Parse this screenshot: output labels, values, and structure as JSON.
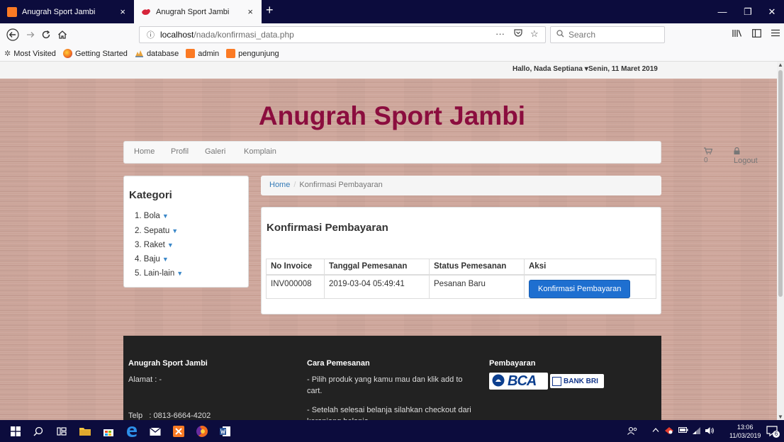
{
  "browser": {
    "tabs": [
      {
        "title": "Anugrah Sport Jambi",
        "close": "×"
      },
      {
        "title": "Anugrah Sport Jambi",
        "close": "×"
      }
    ],
    "new_tab": "+",
    "url_host": "localhost",
    "url_path": "/nada/konfirmasi_data.php",
    "url_actions": [
      "···",
      "☆"
    ],
    "search_placeholder": "Search",
    "window_controls": [
      "—",
      "❐",
      "✕"
    ],
    "bookmarks": [
      "Most Visited",
      "Getting Started",
      "database",
      "admin",
      "pengunjung"
    ]
  },
  "page": {
    "user_menu": "Hallo, Nada Septiana ▾",
    "date": "Senin, 11 Maret 2019",
    "site_title": "Anugrah Sport Jambi",
    "nav": [
      "Home",
      "Profil",
      "Galeri",
      "Komplain"
    ],
    "cart_count": "0",
    "logout": "Logout",
    "kategori": {
      "title": "Kategori",
      "items": [
        "1. Bola",
        "2. Sepatu",
        "3. Raket",
        "4. Baju",
        "5. Lain-lain"
      ]
    },
    "breadcrumb": {
      "home": "Home",
      "sep": "/",
      "current": "Konfirmasi Pembayaran"
    },
    "main": {
      "title": "Konfirmasi Pembayaran",
      "columns": [
        "No Invoice",
        "Tanggal Pemesanan",
        "Status Pemesanan",
        "Aksi"
      ],
      "rows": [
        {
          "invoice": "INV000008",
          "tanggal": "2019-03-04 05:49:41",
          "status": "Pesanan Baru",
          "action": "Konfirmasi Pembayaran"
        }
      ]
    },
    "footer": {
      "col1_title": "Anugrah Sport Jambi",
      "alamat": "Alamat : -",
      "telp": "Telp   : 0813-6664-4202",
      "col2_title": "Cara Pemesanan",
      "step1": "- Pilih produk yang kamu mau dan klik add to cart.",
      "step2": "- Setelah selesai belanja silahkan checkout dari keranjang belanja",
      "col3_title": "Pembayaran",
      "bca": "BCA",
      "bri": "BANK BRI"
    }
  },
  "taskbar": {
    "time": "13:06",
    "date": "11/03/2019",
    "notification_count": "6"
  },
  "colors": {
    "title": "#8b0d3e",
    "button": "#1e6fd0",
    "link": "#337ab7",
    "footer_bg": "#222222",
    "browser_frame": "#0c0c3d"
  }
}
